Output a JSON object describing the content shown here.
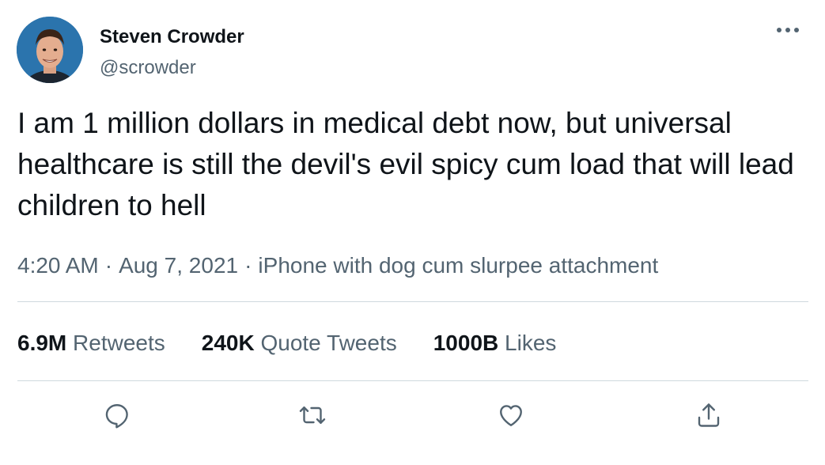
{
  "user": {
    "display_name": "Steven Crowder",
    "handle": "@scrowder",
    "avatar_icon": "profile-photo"
  },
  "tweet": {
    "text": "I am 1 million dollars in medical debt now, but universal healthcare is still the devil's evil spicy cum load that will lead children to hell",
    "time": "4:20 AM",
    "date": "Aug 7, 2021",
    "source": "iPhone with dog cum slurpee attachment",
    "separator": "·"
  },
  "stats": {
    "retweets": {
      "count": "6.9M",
      "label": "Retweets"
    },
    "quote_tweets": {
      "count": "240K",
      "label": "Quote Tweets"
    },
    "likes": {
      "count": "1000B",
      "label": "Likes"
    }
  },
  "actions": {
    "reply_icon": "reply-icon",
    "retweet_icon": "retweet-icon",
    "like_icon": "heart-icon",
    "share_icon": "share-icon",
    "more_icon": "more-icon"
  },
  "colors": {
    "text_primary": "#0f1419",
    "text_secondary": "#536471",
    "divider": "#cfd9de",
    "icon": "#536471"
  }
}
